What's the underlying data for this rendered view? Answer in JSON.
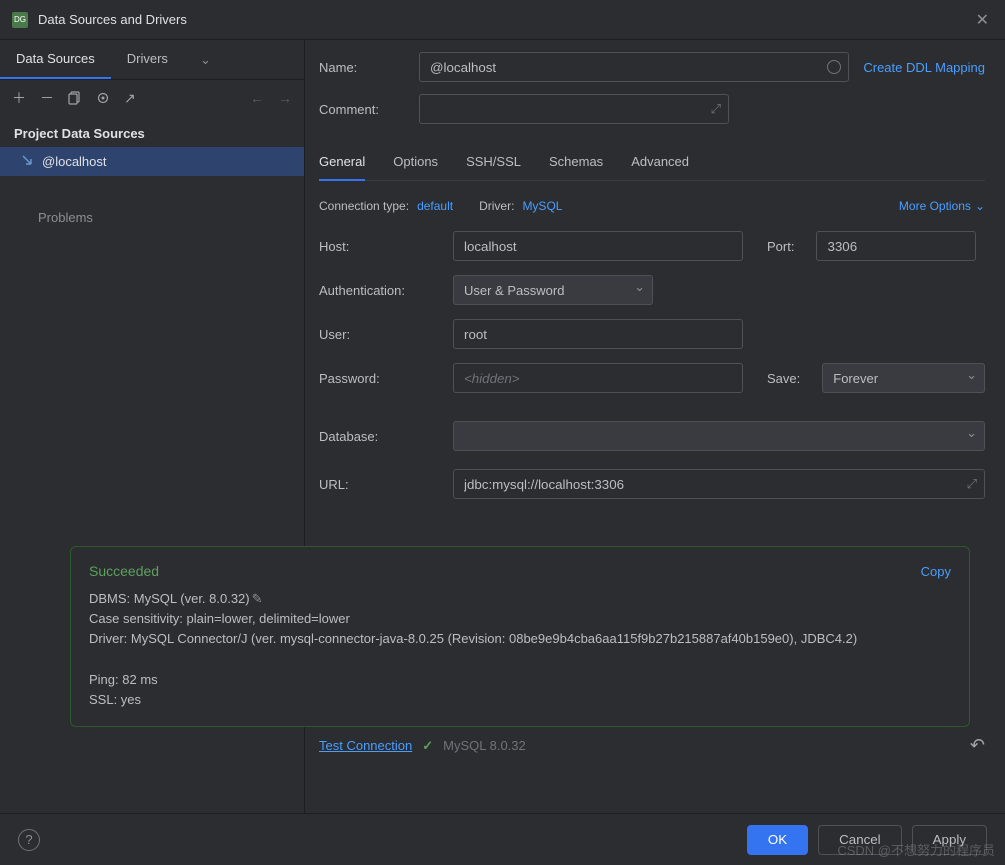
{
  "title": "Data Sources and Drivers",
  "leftTabs": {
    "ds": "Data Sources",
    "drv": "Drivers"
  },
  "sectionHeader": "Project Data Sources",
  "tree": {
    "item0": "@localhost"
  },
  "problems": "Problems",
  "form": {
    "nameLbl": "Name:",
    "name": "@localhost",
    "ddlLink": "Create DDL Mapping",
    "commentLbl": "Comment:",
    "comment": ""
  },
  "tabs": [
    "General",
    "Options",
    "SSH/SSL",
    "Schemas",
    "Advanced"
  ],
  "conn": {
    "typeLbl": "Connection type:",
    "type": "default",
    "drvLbl": "Driver:",
    "drv": "MySQL",
    "more": "More Options"
  },
  "fields": {
    "hostLbl": "Host:",
    "host": "localhost",
    "portLbl": "Port:",
    "port": "3306",
    "authLbl": "Authentication:",
    "auth": "User & Password",
    "userLbl": "User:",
    "user": "root",
    "pwdLbl": "Password:",
    "pwdPh": "<hidden>",
    "saveLbl": "Save:",
    "save": "Forever",
    "dbLbl": "Database:",
    "db": "",
    "urlLbl": "URL:",
    "url": "jdbc:mysql://localhost:3306"
  },
  "popup": {
    "title": "Succeeded",
    "copy": "Copy",
    "l1": "DBMS: MySQL (ver. 8.0.32)",
    "l2": "Case sensitivity: plain=lower, delimited=lower",
    "l3": "Driver: MySQL Connector/J (ver. mysql-connector-java-8.0.25 (Revision: 08be9e9b4cba6aa115f9b27b215887af40b159e0), JDBC4.2)",
    "l4": "Ping: 82 ms",
    "l5": "SSL: yes"
  },
  "test": {
    "label": "Test Connection",
    "ver": "MySQL 8.0.32"
  },
  "footer": {
    "ok": "OK",
    "cancel": "Cancel",
    "apply": "Apply"
  },
  "watermark": "CSDN @不想努力的程序员"
}
